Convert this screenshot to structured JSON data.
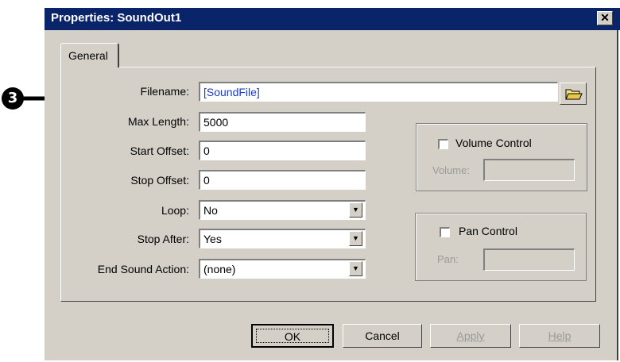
{
  "window": {
    "title": "Properties: SoundOut1",
    "close_glyph": "✕"
  },
  "callout": {
    "number": "3"
  },
  "tabs": [
    {
      "label": "General"
    }
  ],
  "form": {
    "filename": {
      "label": "Filename:",
      "value": "[SoundFile]"
    },
    "max_length": {
      "label": "Max Length:",
      "value": "5000"
    },
    "start_offset": {
      "label": "Start Offset:",
      "value": "0"
    },
    "stop_offset": {
      "label": "Stop Offset:",
      "value": "0"
    },
    "loop": {
      "label": "Loop:",
      "value": "No"
    },
    "stop_after": {
      "label": "Stop After:",
      "value": "Yes"
    },
    "end_sound_action": {
      "label": "End Sound Action:",
      "value": "(none)"
    }
  },
  "volume_group": {
    "checkbox_label": "Volume Control",
    "field_label": "Volume:",
    "checked": false
  },
  "pan_group": {
    "checkbox_label": "Pan Control",
    "field_label": "Pan:",
    "checked": false
  },
  "buttons": {
    "ok": "OK",
    "cancel": "Cancel",
    "apply": "Apply",
    "help": "Help"
  },
  "icons": {
    "browse": "folder-icon",
    "dropdown": "down-arrow-icon",
    "close": "close-icon"
  }
}
